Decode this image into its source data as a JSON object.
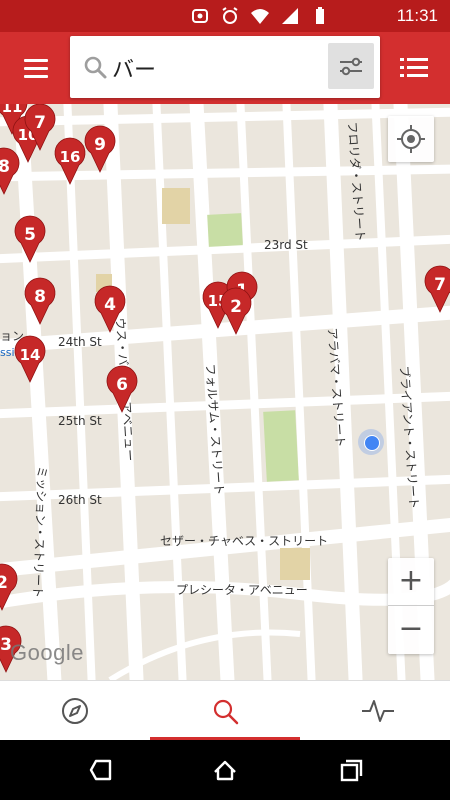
{
  "status_bar": {
    "time": "11:31"
  },
  "search": {
    "query": "バー"
  },
  "map": {
    "streets": [
      {
        "id": "23rd",
        "label": "23rd St"
      },
      {
        "id": "24th",
        "label": "24th St"
      },
      {
        "id": "25th",
        "label": "25th St"
      },
      {
        "id": "26th",
        "label": "26th St"
      },
      {
        "id": "florida",
        "label": "フロリダ・ストリート"
      },
      {
        "id": "alabama",
        "label": "アラバマ・ストリート"
      },
      {
        "id": "bryant",
        "label": "ブライアント・ストリート"
      },
      {
        "id": "folsom",
        "label": "フォルサム・ストリート"
      },
      {
        "id": "south-van-ness",
        "label": "ウス・バネス・アベニュー"
      },
      {
        "id": "mission",
        "label": "ミッション・ストリート"
      },
      {
        "id": "cesar-chavez",
        "label": "セザー・チャベス・ストリート"
      },
      {
        "id": "precita",
        "label": "プレシータ・アベニュー"
      },
      {
        "id": "edge-left",
        "label": "ョン"
      },
      {
        "id": "edge-left-2",
        "label": "ssi"
      }
    ],
    "markers": [
      "11",
      "10",
      "7",
      "8",
      "16",
      "9",
      "5",
      "8",
      "4",
      "14",
      "6",
      "15",
      "1",
      "2",
      "7",
      "2",
      "3"
    ],
    "attribution": "Google",
    "zoom_in": "+",
    "zoom_out": "−"
  },
  "colors": {
    "primary": "#d32f2f",
    "status": "#b71c1c",
    "marker": "#c62828"
  },
  "bottom_nav": {
    "tabs": [
      {
        "name": "navigate",
        "icon": "compass-icon",
        "active": false
      },
      {
        "name": "search",
        "icon": "search-icon",
        "active": true
      },
      {
        "name": "activity",
        "icon": "pulse-icon",
        "active": false
      }
    ]
  }
}
